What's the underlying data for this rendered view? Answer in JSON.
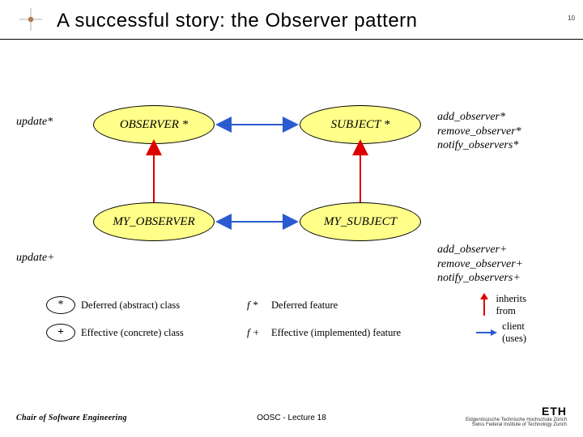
{
  "header": {
    "title": "A successful story: the Observer pattern",
    "slide_number": "10"
  },
  "diagram": {
    "observer_abs": "OBSERVER *",
    "subject_abs": "SUBJECT *",
    "my_observer": "MY_OBSERVER",
    "my_subject": "MY_SUBJECT",
    "left_top_label": "update*",
    "left_bottom_label": "update+",
    "right_top_lines": [
      "add_observer*",
      "remove_observer*",
      "notify_observers*"
    ],
    "right_bottom_lines": [
      "add_observer+",
      "remove_observer+",
      "notify_observers+"
    ]
  },
  "legend": {
    "deferred_sym": "*",
    "deferred_class": "Deferred (abstract) class",
    "effective_sym": "+",
    "effective_class": "Effective (concrete) class",
    "f_deferred_sym": "f *",
    "f_deferred": "Deferred feature",
    "f_effective_sym": "f +",
    "f_effective": "Effective (implemented) feature",
    "inherits_1": "inherits",
    "inherits_2": "from",
    "client_1": "client",
    "client_2": "(uses)"
  },
  "footer": {
    "left": "Chair of Software Engineering",
    "center": "OOSC - Lecture 18",
    "logo": "ETH",
    "logo_sub1": "Eidgenössische Technische Hochschule Zürich",
    "logo_sub2": "Swiss Federal Institute of Technology Zurich"
  },
  "chart_data": {
    "type": "diagram",
    "description": "UML-like class relationship for Observer pattern",
    "nodes": [
      {
        "id": "OBSERVER",
        "kind": "deferred_class",
        "features": [
          "update*"
        ]
      },
      {
        "id": "SUBJECT",
        "kind": "deferred_class",
        "features": [
          "add_observer*",
          "remove_observer*",
          "notify_observers*"
        ]
      },
      {
        "id": "MY_OBSERVER",
        "kind": "effective_class",
        "features": [
          "update+"
        ]
      },
      {
        "id": "MY_SUBJECT",
        "kind": "effective_class",
        "features": [
          "add_observer+",
          "remove_observer+",
          "notify_observers+"
        ]
      }
    ],
    "edges": [
      {
        "from": "MY_OBSERVER",
        "to": "OBSERVER",
        "relation": "inherits"
      },
      {
        "from": "MY_SUBJECT",
        "to": "SUBJECT",
        "relation": "inherits"
      },
      {
        "from": "OBSERVER",
        "to": "SUBJECT",
        "relation": "client",
        "bidirectional": true
      },
      {
        "from": "MY_OBSERVER",
        "to": "MY_SUBJECT",
        "relation": "client",
        "bidirectional": true
      }
    ]
  }
}
